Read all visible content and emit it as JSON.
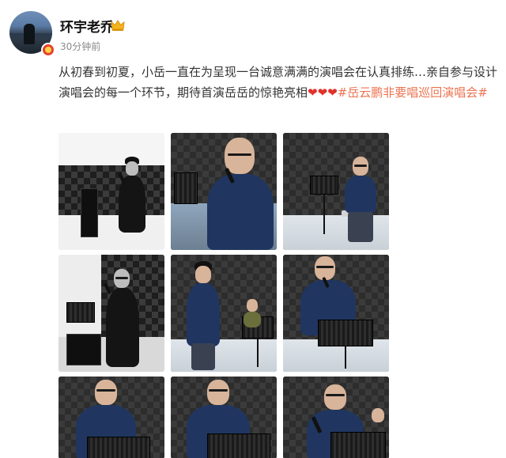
{
  "post": {
    "author": {
      "name": "环宇老乔",
      "badge_icon": "crown-icon",
      "timestamp": "30分钟前"
    },
    "text": {
      "body": "从初春到初夏，小岳一直在为呈现一台诚意满满的演唱会在认真排练…亲自参与设计演唱会的每一个环节，期待首演岳岳的惊艳亮相",
      "hearts": "❤❤❤",
      "hashtag": "#岳云鹏非要唱巡回演唱会#"
    },
    "photos": [
      {
        "label": "photo-1"
      },
      {
        "label": "photo-2"
      },
      {
        "label": "photo-3"
      },
      {
        "label": "photo-4"
      },
      {
        "label": "photo-5"
      },
      {
        "label": "photo-6"
      },
      {
        "label": "photo-7"
      },
      {
        "label": "photo-8"
      },
      {
        "label": "photo-9"
      }
    ]
  },
  "colors": {
    "hashtag": "#eb7350",
    "heart": "#e0322b",
    "shirt": "#203660",
    "timestamp": "#8a8a8a"
  }
}
